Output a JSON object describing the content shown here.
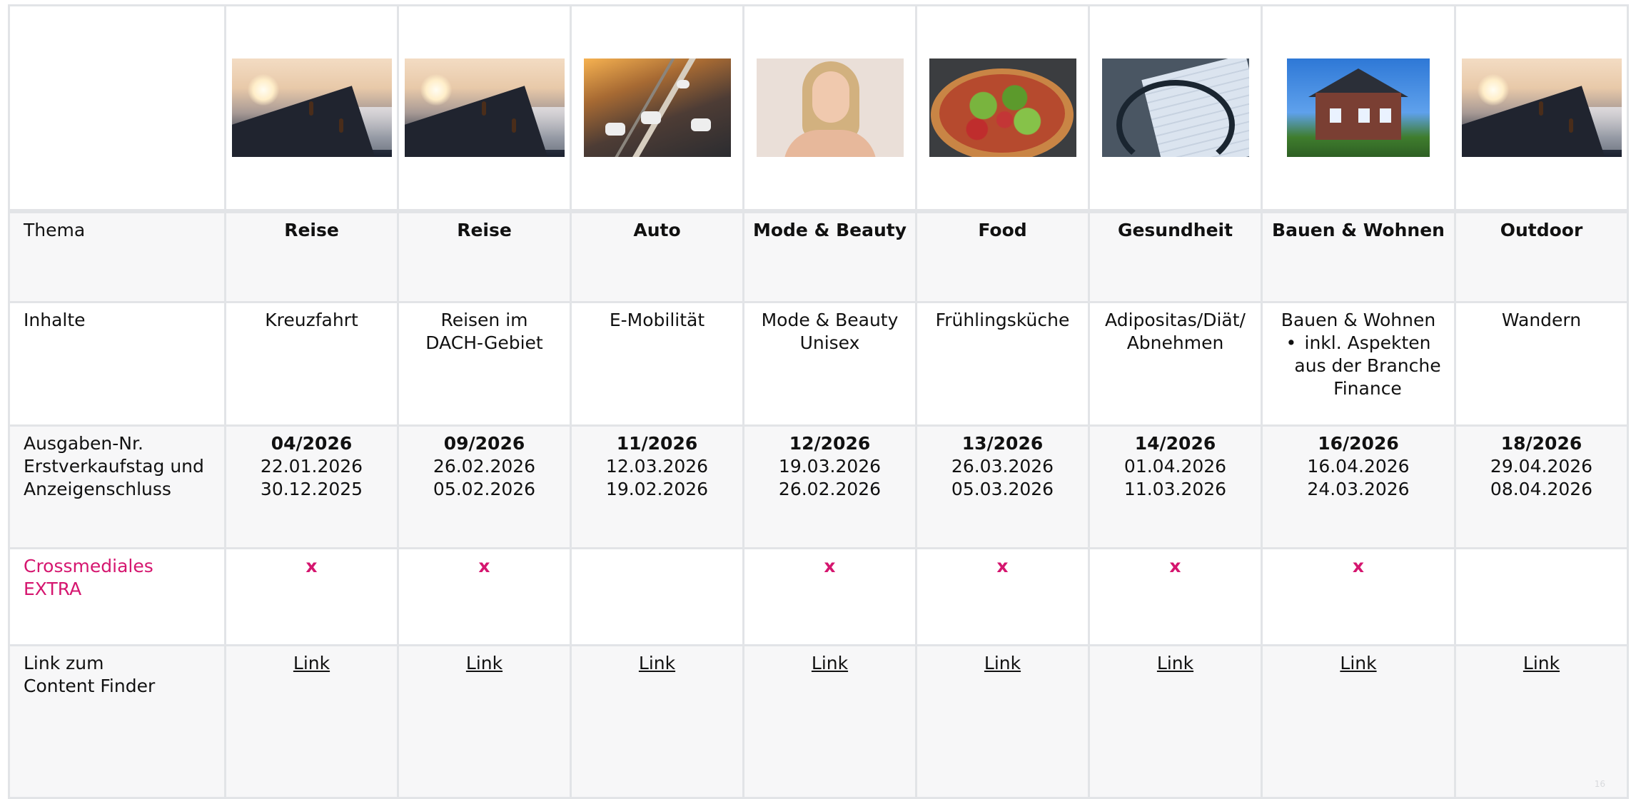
{
  "header": {
    "images": [
      {
        "icon": "cruise-mountain-hiker-image",
        "label": "Reise"
      },
      {
        "icon": "travel-mountain-hiker-image",
        "label": "Reise"
      },
      {
        "icon": "highway-traffic-image",
        "label": "Auto"
      },
      {
        "icon": "smiling-woman-portrait-image",
        "label": "Mode & Beauty"
      },
      {
        "icon": "pizza-image",
        "label": "Food"
      },
      {
        "icon": "stethoscope-documents-image",
        "label": "Gesundheit"
      },
      {
        "icon": "house-solar-panels-image",
        "label": "Bauen & Wohnen"
      },
      {
        "icon": "outdoor-mountain-hiker-image",
        "label": "Outdoor"
      }
    ]
  },
  "rows": {
    "thema": {
      "label": "Thema",
      "values": [
        "Reise",
        "Reise",
        "Auto",
        "Mode & Beauty",
        "Food",
        "Gesundheit",
        "Bauen & Wohnen",
        "Outdoor"
      ]
    },
    "inhalte": {
      "label": "Inhalte",
      "values": [
        [
          "Kreuzfahrt"
        ],
        [
          "Reisen im",
          "DACH-Gebiet"
        ],
        [
          "E-Mobilität"
        ],
        [
          "Mode & Beauty",
          "Unisex"
        ],
        [
          "Frühlingsküche"
        ],
        [
          "Adipositas/Diät/",
          "Abnehmen"
        ],
        [
          "Bauen & Wohnen"
        ],
        [
          "Wandern"
        ]
      ],
      "bullet_col7": {
        "bullet": "•",
        "lines": [
          "inkl. Aspekten",
          "aus der Branche",
          "Finance"
        ]
      }
    },
    "ausgaben": {
      "label_lines": [
        "Ausgaben-Nr.",
        "Erstverkaufstag und",
        "Anzeigenschluss"
      ],
      "values": [
        {
          "nr": "04/2026",
          "evt": "22.01.2026",
          "as": "30.12.2025"
        },
        {
          "nr": "09/2026",
          "evt": "26.02.2026",
          "as": "05.02.2026"
        },
        {
          "nr": "11/2026",
          "evt": "12.03.2026",
          "as": "19.02.2026"
        },
        {
          "nr": "12/2026",
          "evt": "19.03.2026",
          "as": "26.02.2026"
        },
        {
          "nr": "13/2026",
          "evt": "26.03.2026",
          "as": "05.03.2026"
        },
        {
          "nr": "14/2026",
          "evt": "01.04.2026",
          "as": "11.03.2026"
        },
        {
          "nr": "16/2026",
          "evt": "16.04.2026",
          "as": "24.03.2026"
        },
        {
          "nr": "18/2026",
          "evt": "29.04.2026",
          "as": "08.04.2026"
        }
      ]
    },
    "extra": {
      "label_lines": [
        "Crossmediales",
        "EXTRA"
      ],
      "values": [
        "x",
        "x",
        "",
        "x",
        "x",
        "x",
        "x",
        ""
      ]
    },
    "link": {
      "label_lines": [
        "Link zum",
        "Content Finder"
      ],
      "values": [
        "Link",
        "Link",
        "Link",
        "Link",
        "Link",
        "Link",
        "Link",
        "Link"
      ]
    }
  },
  "colors": {
    "accent": "#d5166f",
    "border": "#e2e4e7",
    "row_gray": "#f7f7f8"
  },
  "footer": {
    "watermark": "16"
  }
}
